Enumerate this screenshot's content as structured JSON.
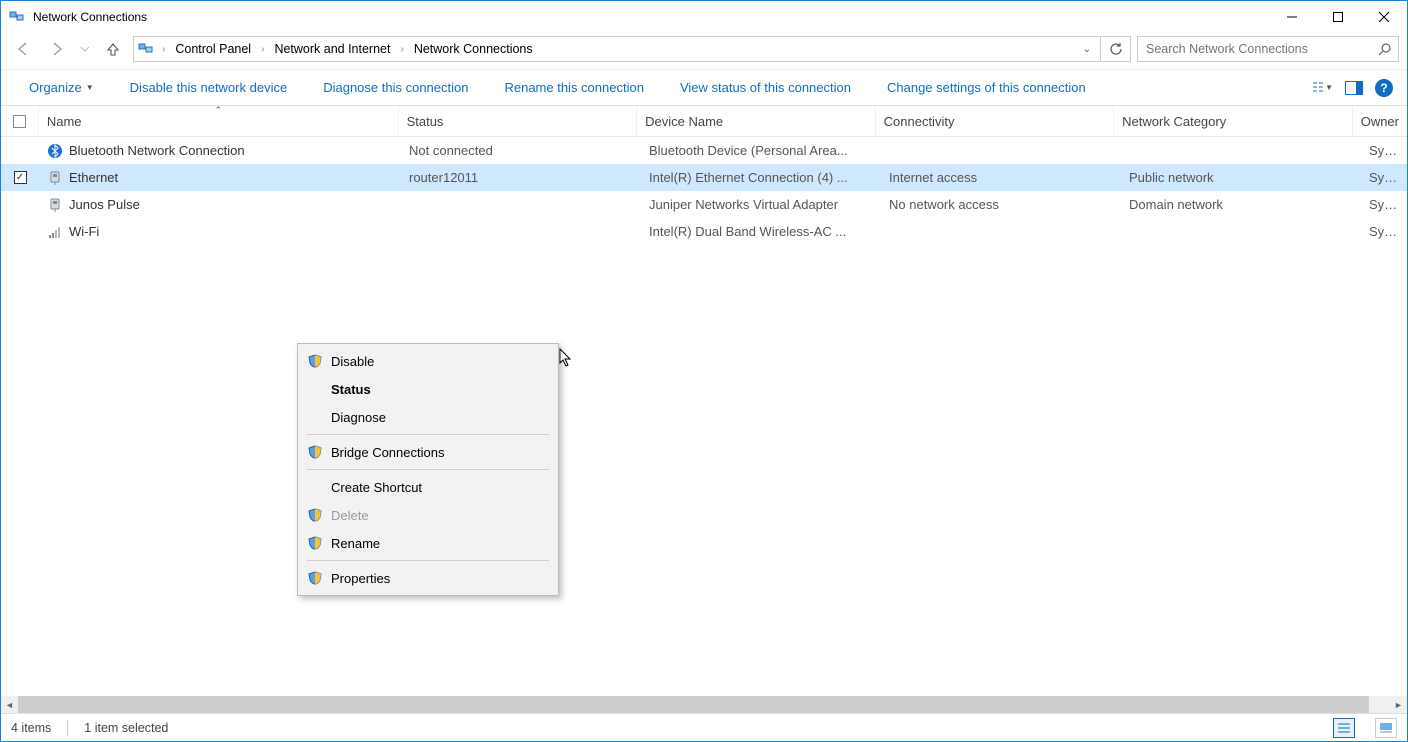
{
  "window": {
    "title": "Network Connections"
  },
  "breadcrumbs": {
    "b0": "Control Panel",
    "b1": "Network and Internet",
    "b2": "Network Connections"
  },
  "search": {
    "placeholder": "Search Network Connections"
  },
  "toolbar": {
    "organize": "Organize",
    "disable": "Disable this network device",
    "diagnose": "Diagnose this connection",
    "rename": "Rename this connection",
    "viewstatus": "View status of this connection",
    "change": "Change settings of this connection"
  },
  "columns": {
    "name": "Name",
    "status": "Status",
    "device": "Device Name",
    "conn": "Connectivity",
    "cat": "Network Category",
    "owner": "Owner"
  },
  "rows": [
    {
      "name": "Bluetooth Network Connection",
      "status": "Not connected",
      "device": "Bluetooth Device (Personal Area...",
      "conn": "",
      "cat": "",
      "owner": "System",
      "icon": "bluetooth",
      "selected": false,
      "checked": false
    },
    {
      "name": "Ethernet",
      "status": "router12011",
      "device": "Intel(R) Ethernet Connection (4) ...",
      "conn": "Internet access",
      "cat": "Public network",
      "owner": "System",
      "icon": "ethernet",
      "selected": true,
      "checked": true
    },
    {
      "name": "Junos Pulse",
      "status": "",
      "device": "Juniper Networks Virtual Adapter",
      "conn": "No network access",
      "cat": "Domain network",
      "owner": "System",
      "icon": "ethernet",
      "selected": false,
      "checked": false
    },
    {
      "name": "Wi-Fi",
      "status": "",
      "device": "Intel(R) Dual Band Wireless-AC ...",
      "conn": "",
      "cat": "",
      "owner": "System",
      "icon": "wifi",
      "selected": false,
      "checked": false
    }
  ],
  "context_menu": {
    "disable": "Disable",
    "status": "Status",
    "diagnose": "Diagnose",
    "bridge": "Bridge Connections",
    "shortcut": "Create Shortcut",
    "delete": "Delete",
    "rename": "Rename",
    "properties": "Properties"
  },
  "statusbar": {
    "count": "4 items",
    "selected": "1 item selected"
  }
}
